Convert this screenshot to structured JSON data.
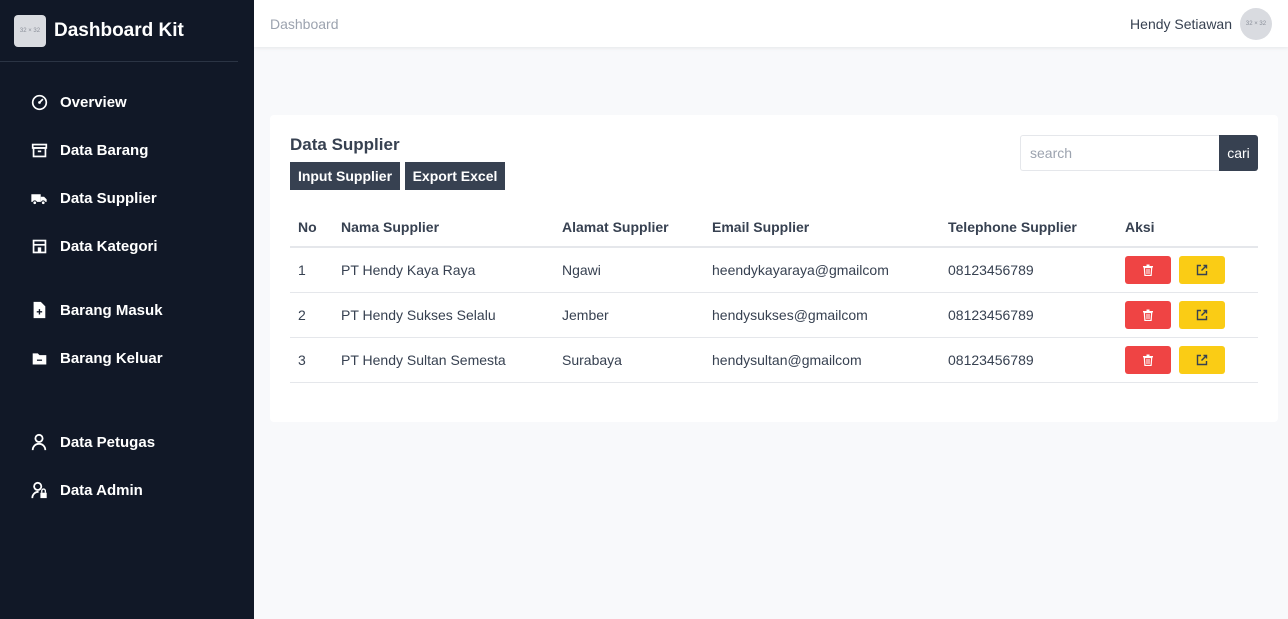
{
  "sidebar": {
    "logo_text": "32 × 32",
    "brand": "Dashboard Kit",
    "items": [
      {
        "label": "Overview",
        "icon": "gauge-icon"
      },
      {
        "label": "Data Barang",
        "icon": "archive-box-icon"
      },
      {
        "label": "Data Supplier",
        "icon": "truck-icon"
      },
      {
        "label": "Data Kategori",
        "icon": "store-icon"
      },
      {
        "label": "Barang Masuk",
        "icon": "file-plus-icon"
      },
      {
        "label": "Barang Keluar",
        "icon": "folder-minus-icon"
      },
      {
        "label": "Data Petugas",
        "icon": "user-icon"
      },
      {
        "label": "Data Admin",
        "icon": "user-lock-icon"
      }
    ]
  },
  "header": {
    "breadcrumb": "Dashboard",
    "user_name": "Hendy Setiawan",
    "avatar_text": "32 × 32"
  },
  "main": {
    "title": "Data Supplier",
    "input_button": "Input Supplier",
    "export_button": "Export Excel",
    "search_placeholder": "search",
    "search_button": "cari",
    "columns": [
      "No",
      "Nama Supplier",
      "Alamat Supplier",
      "Email Supplier",
      "Telephone Supplier",
      "Aksi"
    ],
    "rows": [
      {
        "no": "1",
        "nama": "PT Hendy Kaya Raya",
        "alamat": "Ngawi",
        "email": "heendykayaraya@gmailcom",
        "telp": "08123456789"
      },
      {
        "no": "2",
        "nama": "PT Hendy Sukses Selalu",
        "alamat": "Jember",
        "email": "hendysukses@gmailcom",
        "telp": "08123456789"
      },
      {
        "no": "3",
        "nama": "PT Hendy Sultan Semesta",
        "alamat": "Surabaya",
        "email": "hendysultan@gmailcom",
        "telp": "08123456789"
      }
    ]
  },
  "colors": {
    "sidebar_bg": "#111827",
    "dark_button": "#374151",
    "delete": "#ef4444",
    "edit": "#facc15"
  }
}
